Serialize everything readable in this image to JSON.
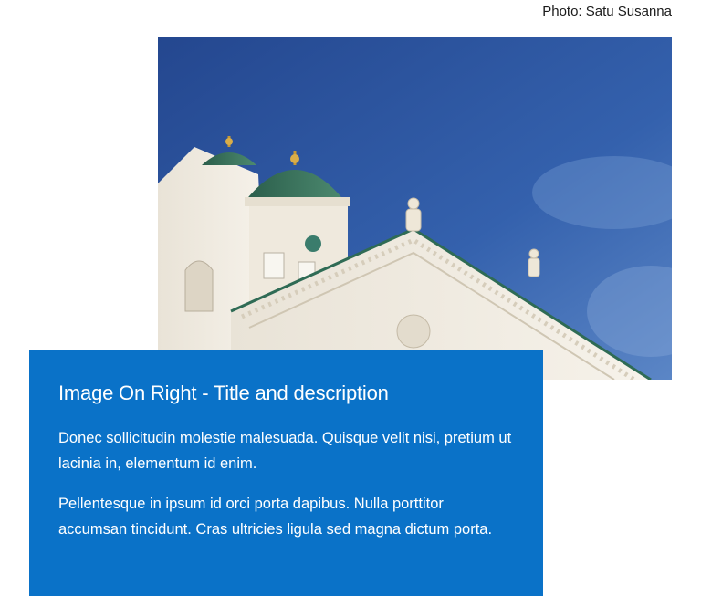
{
  "photo_credit": "Photo: Satu Susanna",
  "image": {
    "subject": "cathedral-photo",
    "sky_color": "#2d55a0",
    "building_color": "#f3efe6",
    "dome_color": "#2f6b55"
  },
  "card": {
    "background_color": "#0a72c8",
    "title": "Image On Right - Title and description",
    "paragraphs": [
      "Donec sollicitudin molestie malesuada. Quisque velit nisi, pretium ut lacinia in, elementum id enim.",
      "Pellentesque in ipsum id orci porta dapibus. Nulla porttitor accumsan tincidunt. Cras ultricies ligula sed magna dictum porta."
    ]
  }
}
